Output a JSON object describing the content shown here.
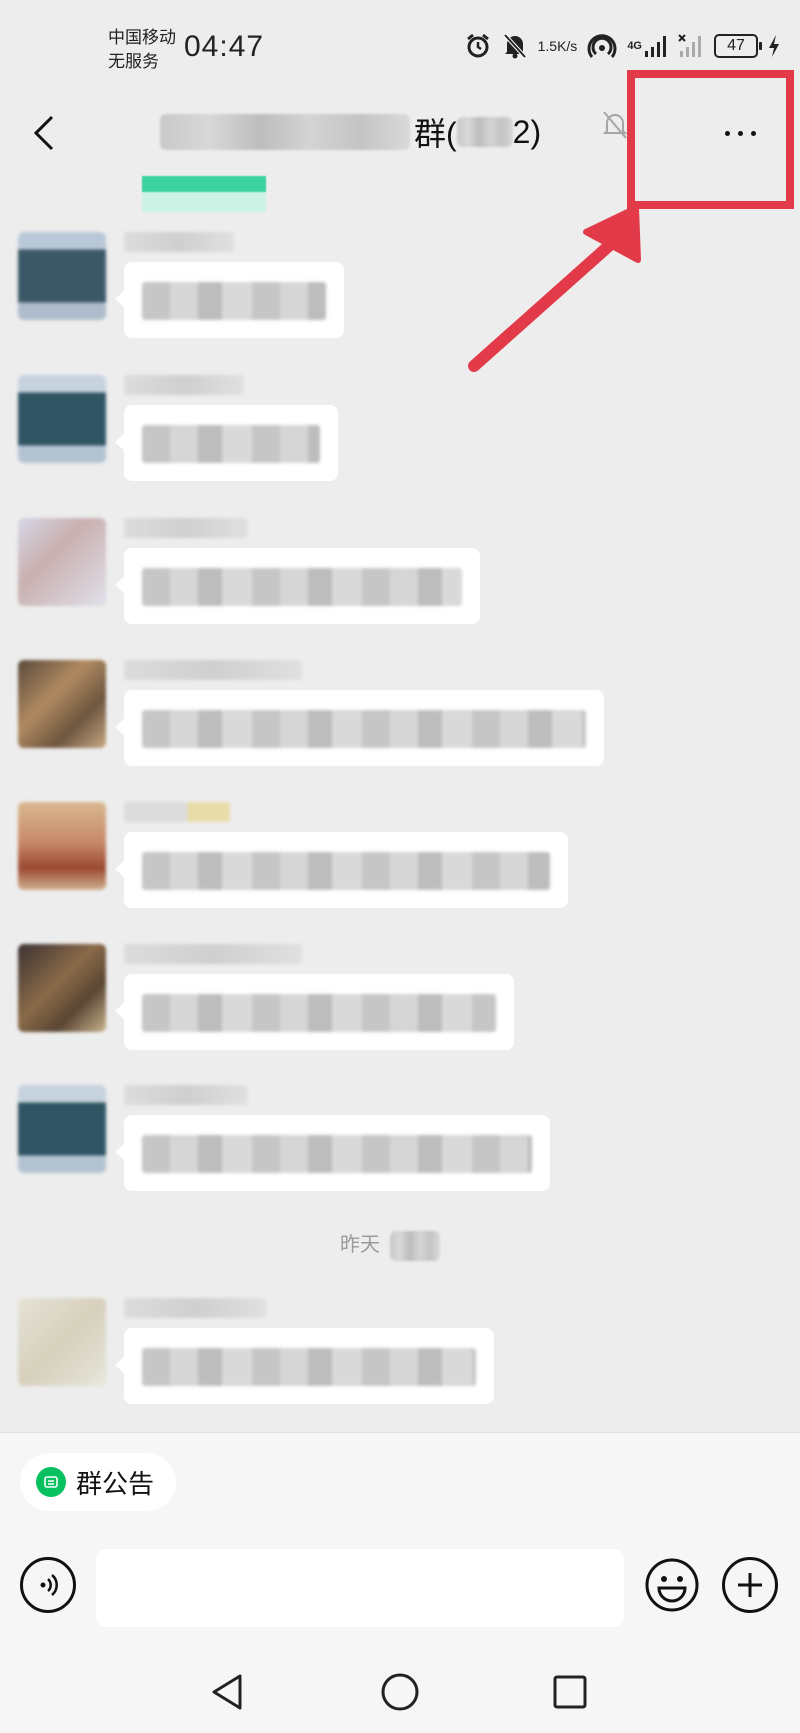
{
  "status_bar": {
    "carrier_line1": "中国移动",
    "carrier_line2": "无服务",
    "time": "04:47",
    "net_speed_value": "1.5",
    "net_speed_unit": "K/s",
    "battery": "47",
    "network_label": "4G",
    "icons": [
      "alarm-icon",
      "mute-icon",
      "hotspot-icon",
      "signal-icon",
      "no-signal-icon",
      "battery-icon",
      "charging-icon"
    ]
  },
  "header": {
    "title_visible_text": "群(",
    "title_suffix": "2)",
    "icons": [
      "back-icon",
      "mute-bell-icon",
      "more-icon"
    ]
  },
  "date_separator": "昨天",
  "bottom": {
    "notice_label": "群公告",
    "input_placeholder": "",
    "icons": [
      "voice-icon",
      "emoji-icon",
      "plus-icon"
    ]
  },
  "system_nav": {
    "icons": [
      "nav-back-icon",
      "nav-home-icon",
      "nav-recents-icon"
    ]
  },
  "colors": {
    "accent_green": "#07c160",
    "annotation_red": "#e23a48",
    "chat_bg": "#ededed"
  }
}
